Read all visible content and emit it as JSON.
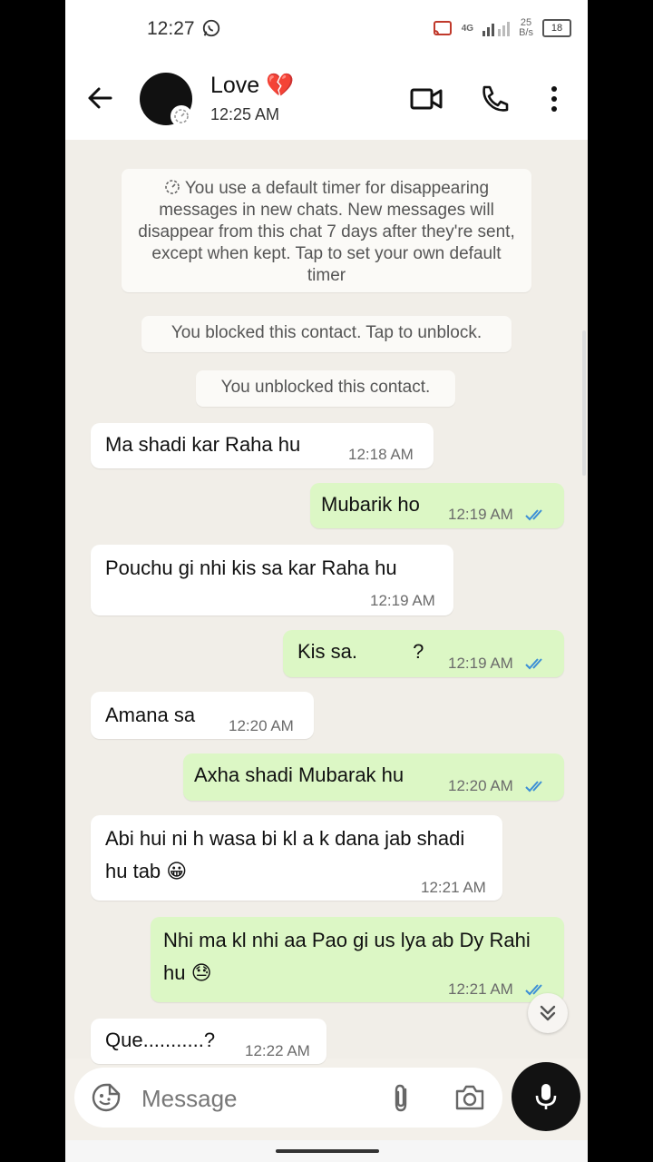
{
  "status_bar": {
    "time": "12:27",
    "network": "4G",
    "speed_value": "25",
    "speed_unit": "B/s",
    "battery": "18"
  },
  "header": {
    "contact_name": "Love 💔",
    "last_seen": "12:25 AM"
  },
  "system_messages": {
    "disappearing": "You use a default timer for disappearing messages in new chats. New messages will disappear from this chat 7 days after they're sent, except when kept. Tap to set your own default timer",
    "blocked": "You blocked this contact. Tap to unblock.",
    "unblocked": "You unblocked this contact."
  },
  "messages": [
    {
      "direction": "in",
      "text": "Ma shadi kar Raha hu",
      "time": "12:18 AM"
    },
    {
      "direction": "out",
      "text": "Mubarik ho",
      "time": "12:19 AM",
      "status": "read"
    },
    {
      "direction": "in",
      "text": "Pouchu gi nhi kis sa kar Raha hu",
      "time": "12:19 AM"
    },
    {
      "direction": "out",
      "text": "Kis sa.          ?",
      "time": "12:19 AM",
      "status": "read"
    },
    {
      "direction": "in",
      "text": "Amana sa",
      "time": "12:20 AM"
    },
    {
      "direction": "out",
      "text": "Axha shadi Mubarak hu",
      "time": "12:20 AM",
      "status": "read"
    },
    {
      "direction": "in",
      "text": "Abi hui ni h wasa bi kl a k dana jab shadi hu tab 😀",
      "time": "12:21 AM"
    },
    {
      "direction": "out",
      "text": "Nhi ma kl nhi aa Pao gi us lya ab Dy Rahi hu 😓",
      "time": "12:21 AM",
      "status": "read"
    },
    {
      "direction": "in",
      "text": "Que...........?",
      "time": "12:22 AM"
    }
  ],
  "composer": {
    "placeholder": "Message"
  },
  "colors": {
    "incoming_bubble": "#ffffff",
    "outgoing_bubble": "#dcf7c5",
    "read_ticks": "#3c8fd6",
    "chat_bg": "#f1eee8"
  },
  "icons": [
    "back-arrow-icon",
    "video-call-icon",
    "voice-call-icon",
    "more-options-icon",
    "sticker-icon",
    "attach-icon",
    "camera-icon",
    "mic-icon",
    "scroll-down-icon",
    "timer-icon",
    "whatsapp-icon"
  ]
}
